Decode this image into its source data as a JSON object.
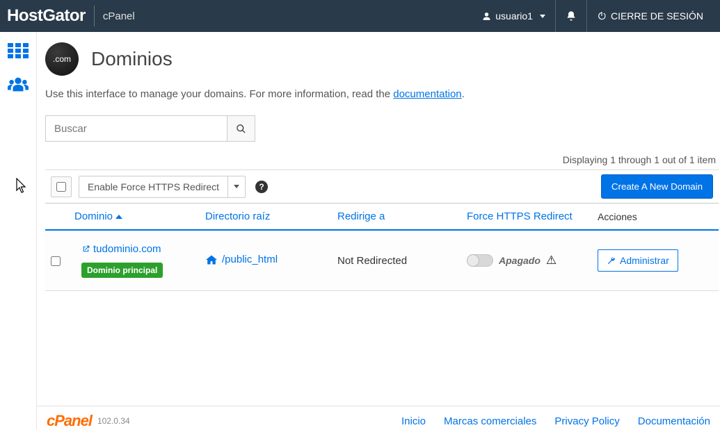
{
  "navbar": {
    "brand": "HostGator",
    "sub": "cPanel",
    "username": "usuario1",
    "logout": "CIERRE DE SESIÓN"
  },
  "page": {
    "icon_text": ".com",
    "title": "Dominios",
    "desc_prefix": "Use this interface to manage your domains. For more information, read the ",
    "desc_link": "documentation",
    "desc_suffix": "."
  },
  "search": {
    "placeholder": "Buscar"
  },
  "results_text": "Displaying 1 through 1 out of 1 item",
  "toolbar": {
    "enable_https": "Enable Force HTTPS Redirect",
    "create_domain": "Create A New Domain"
  },
  "columns": {
    "domain": "Dominio",
    "root": "Directorio raíz",
    "redirect": "Redirige a",
    "https": "Force HTTPS Redirect",
    "actions": "Acciones"
  },
  "row": {
    "domain": "tudominio.com",
    "badge": "Dominio principal",
    "root": "/public_html",
    "redirect": "Not Redirected",
    "https_state": "Apagado",
    "manage": "Administrar"
  },
  "footer": {
    "brand": "cPanel",
    "version": "102.0.34",
    "links": {
      "inicio": "Inicio",
      "marcas": "Marcas comerciales",
      "privacy": "Privacy Policy",
      "docs": "Documentación"
    }
  }
}
